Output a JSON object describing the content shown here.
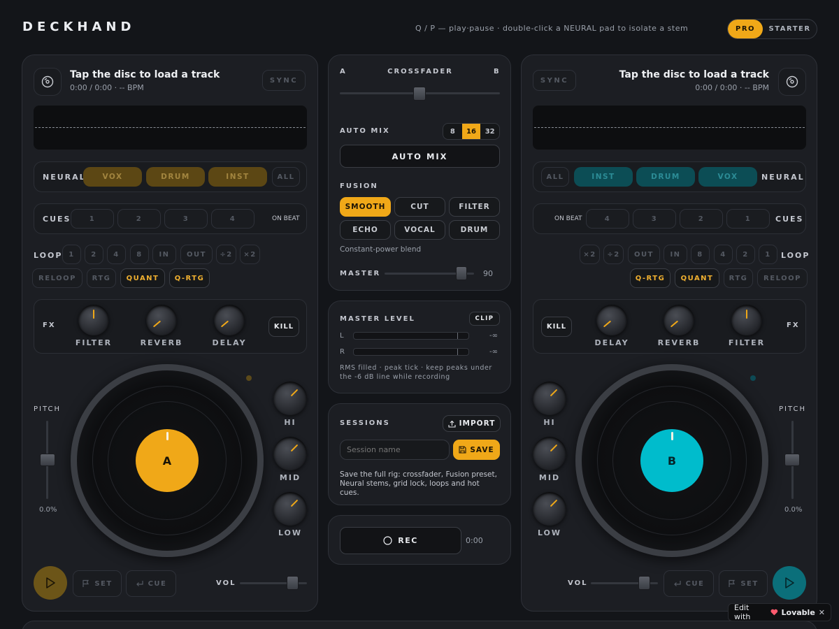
{
  "app": {
    "logo": "DECKHAND",
    "hint": "Q / P — play·pause · double-click a NEURAL pad to isolate a stem",
    "plan": [
      "PRO",
      "STARTER"
    ]
  },
  "deckA": {
    "title": "Tap the disc to load a track",
    "meta": "0:00 / 0:00 · -- BPM",
    "sync": "SYNC",
    "neural": "NEURAL",
    "stems": [
      "VOX",
      "DRUM",
      "INST"
    ],
    "all": "ALL",
    "cues": "CUES",
    "cue_pads": [
      "1",
      "2",
      "3",
      "4"
    ],
    "on_beat": "ON BEAT",
    "loop": "LOOP",
    "loop_btns": [
      "1",
      "2",
      "4",
      "8",
      "IN",
      "OUT",
      "÷2",
      "×2"
    ],
    "loop_row2": [
      "RELOOP",
      "RTG",
      "QUANT",
      "Q-RTG"
    ],
    "fx": "FX",
    "fx_knobs": [
      "FILTER",
      "REVERB",
      "DELAY"
    ],
    "kill": "KILL",
    "pitch": "PITCH",
    "pitch_val": "0.0%",
    "eq": [
      "HI",
      "MID",
      "LOW"
    ],
    "disc_label": "A",
    "set": "SET",
    "cue": "CUE",
    "vol": "VOL"
  },
  "deckB": {
    "title": "Tap the disc to load a track",
    "meta": "0:00 / 0:00 · -- BPM",
    "sync": "SYNC",
    "neural": "NEURAL",
    "stems": [
      "INST",
      "DRUM",
      "VOX"
    ],
    "all": "ALL",
    "cues": "CUES",
    "cue_pads": [
      "4",
      "3",
      "2",
      "1"
    ],
    "on_beat": "ON BEAT",
    "loop": "LOOP",
    "loop_btns": [
      "×2",
      "÷2",
      "OUT",
      "IN",
      "8",
      "4",
      "2",
      "1"
    ],
    "loop_row2": [
      "Q-RTG",
      "QUANT",
      "RTG",
      "RELOOP"
    ],
    "fx": "FX",
    "fx_knobs": [
      "DELAY",
      "REVERB",
      "FILTER"
    ],
    "kill": "KILL",
    "pitch": "PITCH",
    "pitch_val": "0.0%",
    "eq": [
      "HI",
      "MID",
      "LOW"
    ],
    "disc_label": "B",
    "set": "SET",
    "cue": "CUE",
    "vol": "VOL"
  },
  "mixer": {
    "a": "A",
    "b": "B",
    "crossfader": "CROSSFADER",
    "crossfader_value": 0.5,
    "automix": "AUTO MIX",
    "bars": [
      "8",
      "16",
      "32"
    ],
    "automix_btn": "AUTO MIX",
    "fusion": "FUSION",
    "fusion_modes": [
      "SMOOTH",
      "CUT",
      "FILTER",
      "ECHO",
      "VOCAL",
      "DRUM"
    ],
    "fusion_desc": "Constant-power blend",
    "master": "MASTER",
    "master_val": "90"
  },
  "level": {
    "title": "MASTER LEVEL",
    "clip": "CLIP",
    "l": "L",
    "r": "R",
    "l_val": "-∞",
    "r_val": "-∞",
    "note": "RMS filled · peak tick · keep peaks under the -6 dB line while recording"
  },
  "sessions": {
    "title": "SESSIONS",
    "import": "IMPORT",
    "placeholder": "Session name",
    "save": "SAVE",
    "desc": "Save the full rig: crossfader, Fusion preset, Neural stems, grid lock, loops and hot cues."
  },
  "rec": {
    "label": "REC",
    "time": "0:00"
  },
  "badge": {
    "text": "Edit with",
    "brand": "Lovable",
    "close": "✕"
  },
  "colors": {
    "amber": "#f0a818",
    "cyan": "#00bccc"
  }
}
